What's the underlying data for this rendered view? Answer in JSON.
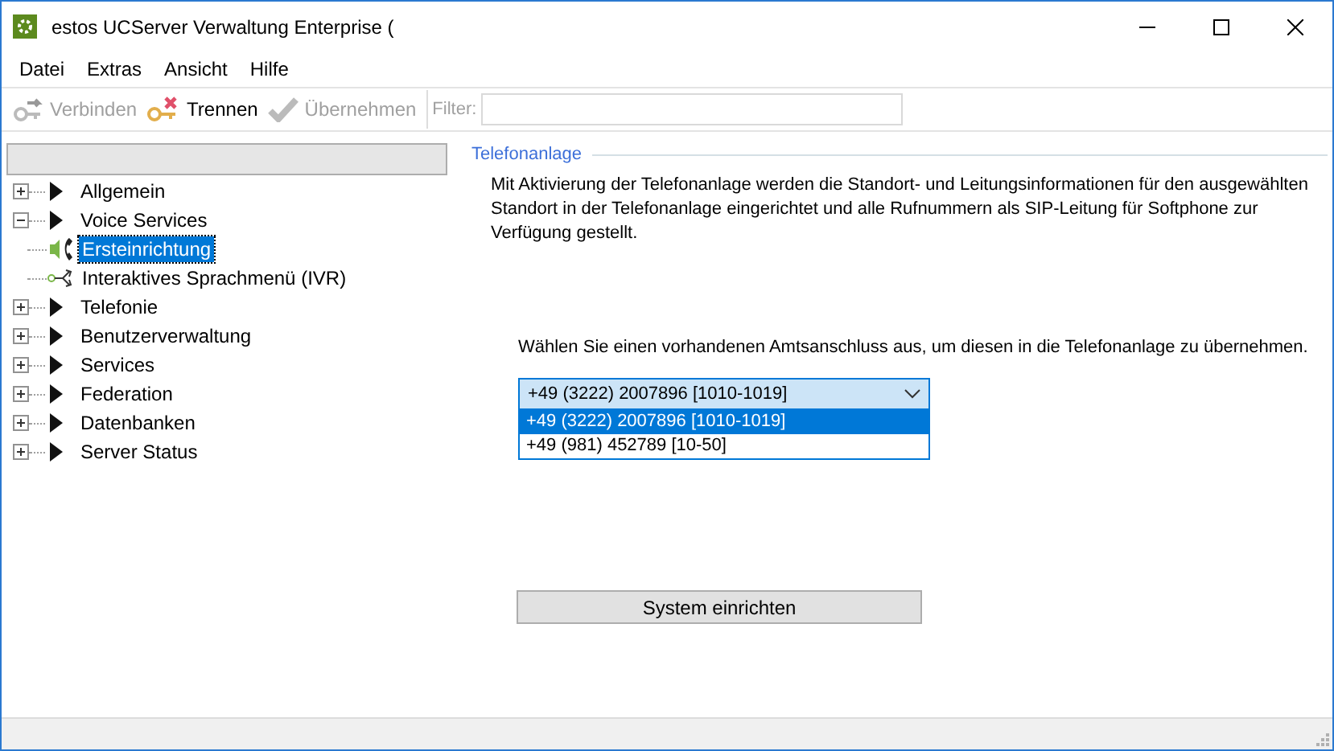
{
  "window": {
    "title": "estos UCServer Verwaltung Enterprise ("
  },
  "menu": [
    "Datei",
    "Extras",
    "Ansicht",
    "Hilfe"
  ],
  "toolbar": {
    "buttons": [
      {
        "label": "Verbinden",
        "kind": "connect",
        "disabled": true
      },
      {
        "label": "Trennen",
        "kind": "disconnect",
        "disabled": false
      },
      {
        "label": "Übernehmen",
        "kind": "apply",
        "disabled": true
      }
    ],
    "filter": {
      "label": "Filter:"
    }
  },
  "tree": [
    {
      "label": "Allgemein",
      "expanded": false,
      "selected": false
    },
    {
      "label": "Voice Services",
      "expanded": true,
      "selected": false,
      "children": [
        {
          "label": "Ersteinrichtung",
          "kind": "phone",
          "selected": true
        },
        {
          "label": "Interaktives Sprachmenü (IVR)",
          "kind": "ivr",
          "selected": false
        }
      ]
    },
    {
      "label": "Telefonie",
      "expanded": false,
      "selected": false
    },
    {
      "label": "Benutzerverwaltung",
      "expanded": false,
      "selected": false
    },
    {
      "label": "Services",
      "expanded": false,
      "selected": false
    },
    {
      "label": "Federation",
      "expanded": false,
      "selected": false
    },
    {
      "label": "Datenbanken",
      "expanded": false,
      "selected": false
    },
    {
      "label": "Server Status",
      "expanded": false,
      "selected": false
    }
  ],
  "panel": {
    "group_title": "Telefonanlage",
    "description": "Mit Aktivierung der Telefonanlage werden die Standort- und Leitungsinformationen für den ausgewählten Standort in der Telefonanlage eingerichtet und alle Rufnummern als SIP-Leitung für Softphone zur Verfügung gestellt.",
    "prompt": "Wählen Sie einen vorhandenen Amtsanschluss aus, um diesen in die Telefonanlage zu übernehmen.",
    "dropdown": {
      "value": "+49 (3222) 2007896 [1010-1019]",
      "expanded": true,
      "options": [
        {
          "label": "+49 (3222) 2007896 [1010-1019]",
          "selected": true
        },
        {
          "label": "+49 (981) 452789 [10-50]",
          "selected": false
        }
      ]
    },
    "button": "System einrichten"
  }
}
